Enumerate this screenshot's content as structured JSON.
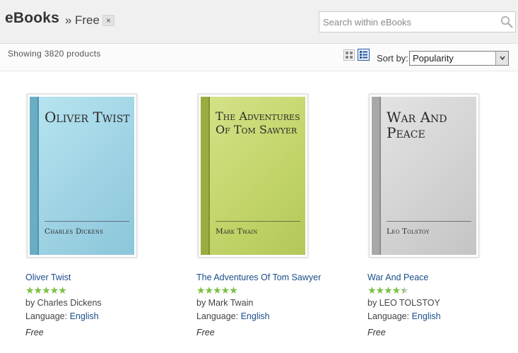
{
  "header": {
    "title": "eBooks",
    "breadcrumb_separator": "»",
    "breadcrumb": "Free",
    "clear_filter_symbol": "×",
    "search_placeholder": "Search within eBooks",
    "search_icon": "magnifier-icon"
  },
  "toolbar": {
    "result_count": "Showing 3820 products",
    "view_icons": [
      "grid-view-icon",
      "list-view-icon"
    ],
    "sort_label": "Sort by:",
    "sort_value": "Popularity"
  },
  "products": [
    {
      "cover_title": "Oliver Twist",
      "cover_author": "Charles Dickens",
      "title": "Oliver Twist",
      "rating": 5,
      "author_line": "by Charles Dickens",
      "language_label": "Language:",
      "language": "English",
      "price": "Free",
      "cover_color": "#9ed3e3"
    },
    {
      "cover_title": "The Adventures Of Tom Sawyer",
      "cover_author": "Mark Twain",
      "title": "The Adventures Of Tom Sawyer",
      "rating": 5,
      "author_line": "by Mark Twain",
      "language_label": "Language:",
      "language": "English",
      "price": "Free",
      "cover_color": "#c6d86e"
    },
    {
      "cover_title": "War And Peace",
      "cover_author": "Leo Tolstoy",
      "title": "War And Peace",
      "rating": 4.5,
      "author_line": "by LEO TOLSTOY",
      "language_label": "Language:",
      "language": "English",
      "price": "Free",
      "cover_color": "#d6d6d6"
    }
  ],
  "colors": {
    "link": "#1a4e8a",
    "star": "#7ac142",
    "header_bg": "#f0f0f0"
  }
}
